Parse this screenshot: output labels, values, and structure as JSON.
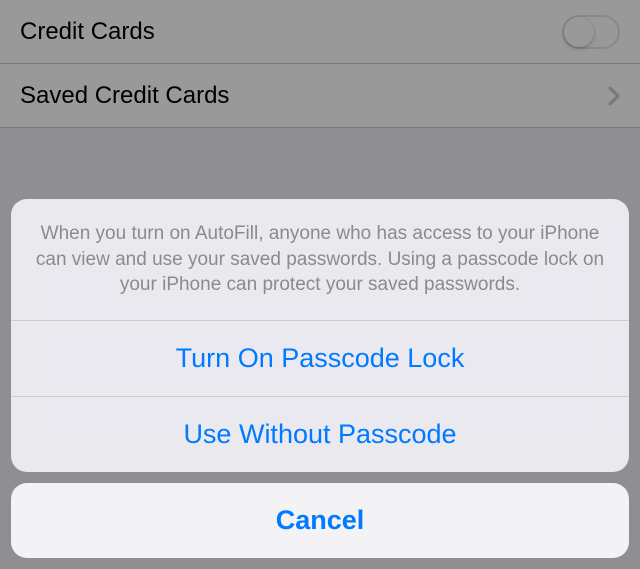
{
  "settings": {
    "rows": [
      {
        "label": "Credit Cards",
        "type": "toggle",
        "on": false
      },
      {
        "label": "Saved Credit Cards",
        "type": "disclosure"
      }
    ]
  },
  "actionSheet": {
    "message": "When you turn on AutoFill, anyone who has access to your iPhone can view and use your saved passwords. Using a passcode lock on your iPhone can protect your saved passwords.",
    "options": [
      {
        "label": "Turn On Passcode Lock"
      },
      {
        "label": "Use Without Passcode"
      }
    ],
    "cancel": "Cancel"
  },
  "colors": {
    "accent": "#007aff",
    "secondaryText": "#8a8a8f"
  }
}
